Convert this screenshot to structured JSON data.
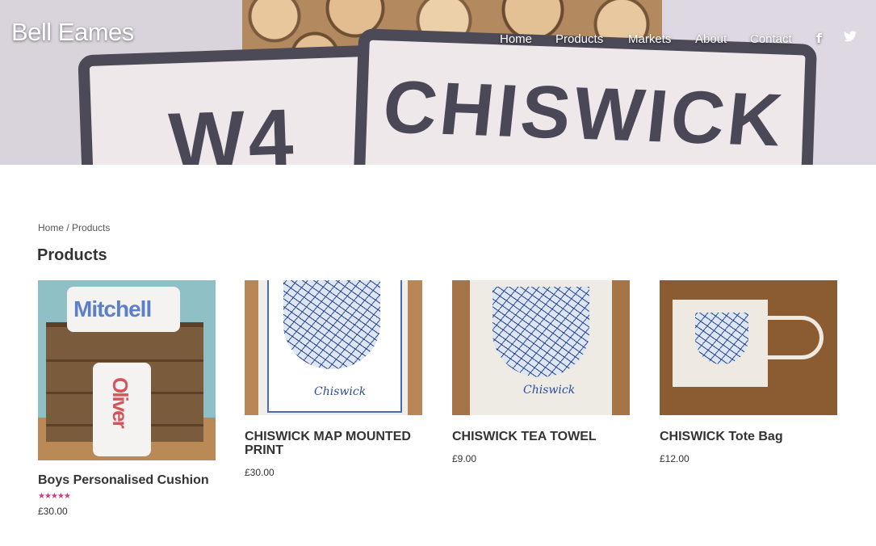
{
  "site": {
    "brand": "Bell Eames"
  },
  "nav": {
    "items": [
      "Home",
      "Products",
      "Markets",
      "About",
      "Contact"
    ],
    "social": [
      {
        "icon": "facebook-icon",
        "glyph": "f"
      },
      {
        "icon": "twitter-icon",
        "glyph": "t"
      }
    ]
  },
  "hero": {
    "pillow_left_text": "W4",
    "pillow_right_text": "CHISWICK"
  },
  "breadcrumb": {
    "home": "Home",
    "separator": " / ",
    "current": "Products"
  },
  "page": {
    "title": "Products"
  },
  "products": [
    {
      "name": "Boys Personalised Cushion",
      "price": "£30.00",
      "rating": 5,
      "rating_stars": "★★★★★",
      "thumb_words": [
        "Mitchell",
        "Oliver"
      ]
    },
    {
      "name": "CHISWICK MAP MOUNTED PRINT",
      "price": "£30.00",
      "thumb_caption": "Chiswick"
    },
    {
      "name": "CHISWICK TEA TOWEL",
      "price": "£9.00",
      "thumb_caption": "Chiswick"
    },
    {
      "name": "CHISWICK Tote Bag",
      "price": "£12.00"
    }
  ],
  "colors": {
    "star": "#d63a85",
    "map_ink": "#1f3f8d"
  }
}
